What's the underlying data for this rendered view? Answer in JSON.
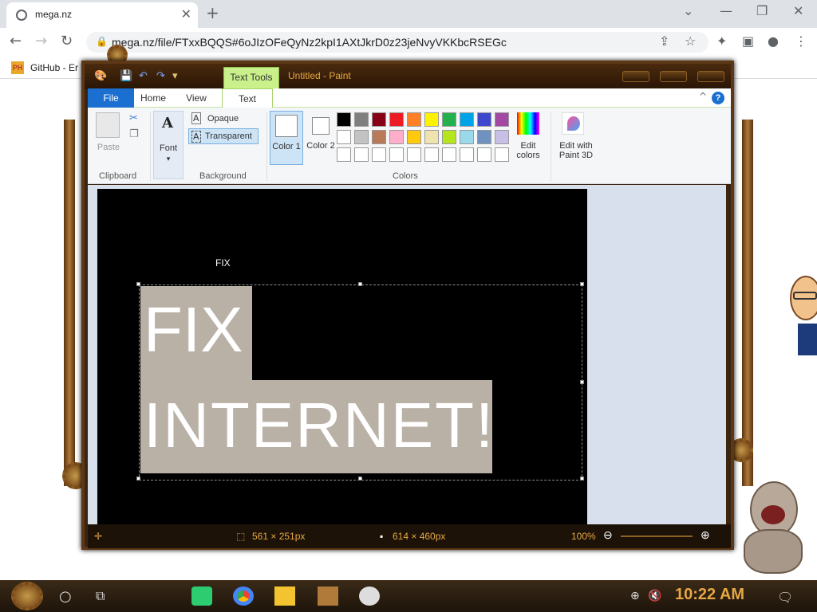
{
  "browser": {
    "tab_title": "mega.nz",
    "url": "mega.nz/file/FTxxBQQS#6oJIzOFeQyNz2kpI1AXtJkrD0z23jeNvyVKKbcRSEGc",
    "bookmark": "GitHub - Er",
    "bookmark_icon": "PH"
  },
  "paint": {
    "context_tab": "Text Tools",
    "title": "Untitled - Paint",
    "tabs": {
      "file": "File",
      "home": "Home",
      "view": "View",
      "text": "Text"
    },
    "help": "?",
    "clipboard": {
      "paste": "Paste",
      "label": "Clipboard"
    },
    "font": {
      "label": "Font",
      "glyph": "A"
    },
    "background": {
      "opaque": "Opaque",
      "transparent": "Transparent",
      "label": "Background"
    },
    "colors": {
      "color1": "Color 1",
      "color2": "Color 2",
      "edit": "Edit colors",
      "paint3d": "Edit with Paint 3D",
      "label": "Colors",
      "palette_row1": [
        "#000000",
        "#7f7f7f",
        "#880015",
        "#ed1c24",
        "#ff7f27",
        "#fff200",
        "#22b14c",
        "#00a2e8",
        "#3f48cc",
        "#a349a4"
      ],
      "palette_row2": [
        "#ffffff",
        "#c3c3c3",
        "#b97a57",
        "#ffaec9",
        "#ffc90e",
        "#efe4b0",
        "#b5e61d",
        "#99d9ea",
        "#7092be",
        "#c8bfe7"
      ],
      "palette_row3": [
        "#ffffff",
        "#ffffff",
        "#ffffff",
        "#ffffff",
        "#ffffff",
        "#ffffff",
        "#ffffff",
        "#ffffff",
        "#ffffff",
        "#ffffff"
      ]
    },
    "canvas": {
      "small_text": "FIX",
      "big_line1": "FIX",
      "big_line2": "INTERNET!"
    },
    "status": {
      "selection_size": "561 × 251px",
      "canvas_size": "614 × 460px",
      "zoom": "100%"
    }
  },
  "taskbar": {
    "clock": "10:22 AM"
  }
}
